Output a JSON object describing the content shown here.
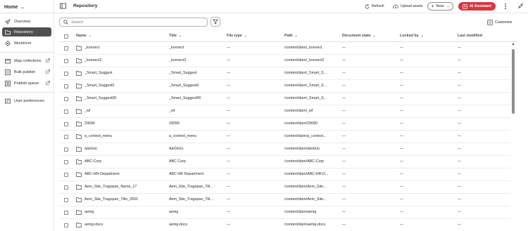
{
  "sidebar": {
    "home_label": "Home",
    "items": [
      {
        "label": "Overview",
        "icon": "compass-icon"
      },
      {
        "label": "Repository",
        "icon": "folder-icon",
        "active": true
      },
      {
        "label": "Workfront",
        "icon": "workfront-icon"
      },
      {
        "label": "Map collections",
        "icon": "collection-icon",
        "external": true
      },
      {
        "label": "Bulk publish",
        "icon": "publish-icon",
        "external": true
      },
      {
        "label": "Publish queue",
        "icon": "queue-icon",
        "external": true
      },
      {
        "label": "User preferences",
        "icon": "preferences-icon"
      }
    ]
  },
  "topbar": {
    "title": "Repository",
    "refresh_label": "Refresh",
    "upload_label": "Upload assets",
    "new_label": "New",
    "ai_label": "AI Assistant"
  },
  "toolbar": {
    "search_placeholder": "Search",
    "customise_label": "Customise"
  },
  "table": {
    "columns": [
      "Name",
      "Title",
      "File type",
      "Path",
      "Document state",
      "Locked by",
      "Last modified"
    ],
    "rows": [
      {
        "name": "_konnect",
        "title": "_konnect",
        "file_type": "—",
        "path": "/content/dam/_konnect",
        "state": "—",
        "locked": "—",
        "modified": "—"
      },
      {
        "name": "_konnect2",
        "title": "_konnect2",
        "file_type": "—",
        "path": "/content/dam/_konnect2",
        "state": "—",
        "locked": "—",
        "modified": "—"
      },
      {
        "name": "_Smart_Suggest",
        "title": "_Smart_Suggest",
        "file_type": "—",
        "path": "/content/dam/_Smart_S...",
        "state": "—",
        "locked": "—",
        "modified": "—"
      },
      {
        "name": "_Smart_Suggest0",
        "title": "_Smart_Suggest0",
        "file_type": "—",
        "path": "/content/dam/_Smart_S...",
        "state": "—",
        "locked": "—",
        "modified": "—"
      },
      {
        "name": "_Smart_Suggest00",
        "title": "_Smart_Suggest00",
        "file_type": "—",
        "path": "/content/dam/_Smart_S...",
        "state": "—",
        "locked": "—",
        "modified": "—"
      },
      {
        "name": "_wf",
        "title": "_wf",
        "file_type": "—",
        "path": "/content/dam/_wf",
        "state": "—",
        "locked": "—",
        "modified": "—"
      },
      {
        "name": "29090",
        "title": "29090",
        "file_type": "—",
        "path": "/content/dam/29090",
        "state": "—",
        "locked": "—",
        "modified": "—"
      },
      {
        "name": "a_context_menu",
        "title": "a_context_menu",
        "file_type": "—",
        "path": "/content/dam/a_context...",
        "state": "—",
        "locked": "—",
        "modified": "—"
      },
      {
        "name": "äàööüü",
        "title": "ÄàÖöÜü",
        "file_type": "—",
        "path": "/content/dam/äàööüü",
        "state": "—",
        "locked": "—",
        "modified": "—"
      },
      {
        "name": "ABC-Corp",
        "title": "ABC Corp",
        "file_type": "—",
        "path": "/content/dam/ABC-Corp",
        "state": "—",
        "locked": "—",
        "modified": "—"
      },
      {
        "name": "ABC-HR-Department",
        "title": "ABC HR Department",
        "file_type": "—",
        "path": "/content/dam/ABC-HR-D...",
        "state": "—",
        "locked": "—",
        "modified": "—"
      },
      {
        "name": "Aem_Site_Tragopan_Name_17",
        "title": "Aem_Site_Tragopan_Titl...",
        "file_type": "—",
        "path": "/content/dam/Aem_Site...",
        "state": "—",
        "locked": "—",
        "modified": "—"
      },
      {
        "name": "Aem_Site_Tragopan_Title_2502",
        "title": "Aem_Site_Tragopan_Titl...",
        "file_type": "—",
        "path": "/content/dam/Aem_Site...",
        "state": "—",
        "locked": "—",
        "modified": "—"
      },
      {
        "name": "aemg",
        "title": "aemg",
        "file_type": "—",
        "path": "/content/dam/aemg",
        "state": "—",
        "locked": "—",
        "modified": "—"
      },
      {
        "name": "aemg-docs",
        "title": "aemg-docs",
        "file_type": "—",
        "path": "/content/dam/aemg-docs",
        "state": "—",
        "locked": "—",
        "modified": "—"
      }
    ]
  }
}
